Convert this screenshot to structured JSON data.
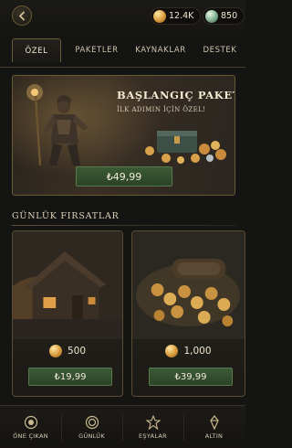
{
  "header": {
    "back_icon": "chevron-left-icon",
    "currencies": [
      {
        "icon": "gold-coin-icon",
        "value": "12.4K"
      },
      {
        "icon": "gem-icon",
        "value": "850"
      }
    ]
  },
  "tabs": [
    {
      "label": "ÖZEL",
      "active": true
    },
    {
      "label": "PAKETLER",
      "active": false
    },
    {
      "label": "KAYNAKLAR",
      "active": false
    },
    {
      "label": "DESTEK",
      "active": false
    }
  ],
  "starter_pack": {
    "title": "BAŞLANGIÇ PAKETİ",
    "subtitle": "İLK ADIMIN İÇİN ÖZEL!",
    "price": "₺49,99"
  },
  "daily_deals": {
    "title": "GÜNLÜK FIRSATLAR",
    "items": [
      {
        "amount": "500",
        "amount_icon": "gold-coin-icon",
        "price": "₺19,99"
      },
      {
        "amount": "1,000",
        "amount_icon": "gold-coin-icon",
        "price": "₺39,99"
      }
    ]
  },
  "bottom_nav": [
    {
      "label": "ÖNE ÇIKAN",
      "icon": "featured-icon"
    },
    {
      "label": "GÜNLÜK",
      "icon": "daily-icon"
    },
    {
      "label": "EŞYALAR",
      "icon": "items-icon"
    },
    {
      "label": "ALTIN",
      "icon": "gold-icon"
    }
  ],
  "colors": {
    "background": "#141413",
    "accent_gold": "#6b5a38",
    "price_button": "#3c5a36",
    "text": "#e6dcc4"
  }
}
